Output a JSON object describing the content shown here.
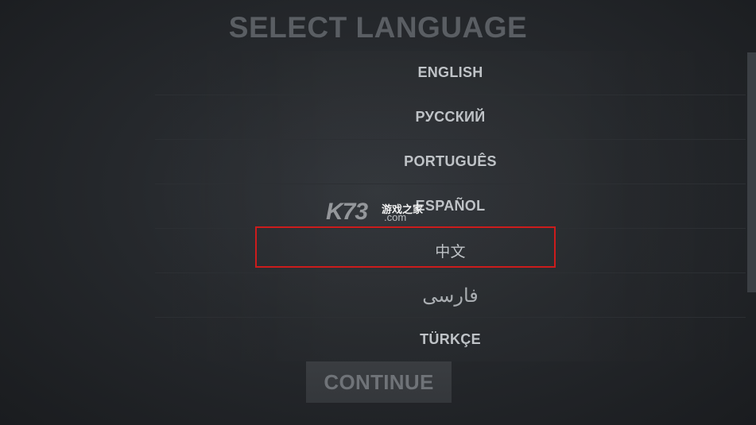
{
  "title": "SELECT LANGUAGE",
  "languages": [
    {
      "label": "ENGLISH"
    },
    {
      "label": "РУССКИЙ"
    },
    {
      "label": "PORTUGUÊS"
    },
    {
      "label": "ESPAÑOL"
    },
    {
      "label": "中文"
    },
    {
      "label": "فارسی"
    },
    {
      "label": "TÜRKÇE"
    }
  ],
  "selected_language": "中文",
  "continue_label": "CONTINUE",
  "watermark": {
    "brand": "K73",
    "site_cn": "游戏之家",
    "domain": ".com"
  },
  "colors": {
    "selection_border": "#cc1c1c",
    "title": "#5a5e63",
    "item_text": "#bfc3c7"
  }
}
